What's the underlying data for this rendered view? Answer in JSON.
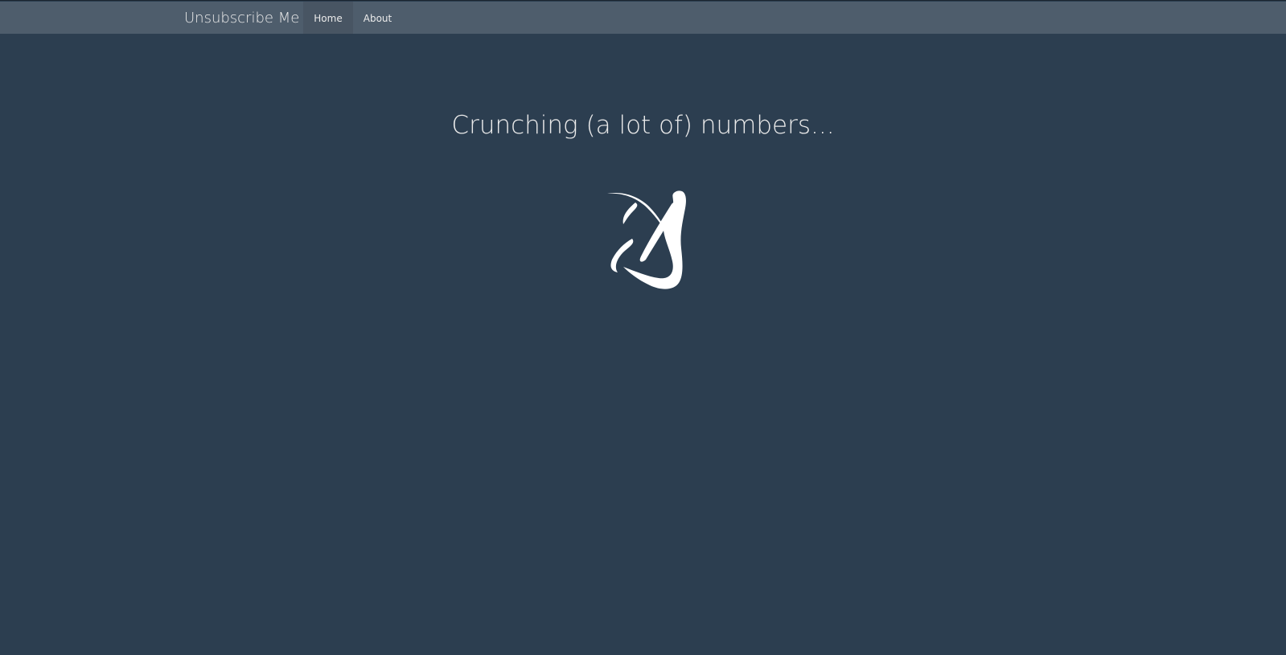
{
  "navbar": {
    "brand": "Unsubscribe Me",
    "items": [
      {
        "label": "Home",
        "active": true
      },
      {
        "label": "About",
        "active": false
      }
    ]
  },
  "main": {
    "headline": "Crunching (a lot of) numbers...",
    "loading_icon": "atom-spinner-icon"
  },
  "colors": {
    "background": "#2c3e50",
    "navbar": "#4e5d6c",
    "active_nav": "#485563",
    "text": "#ebebeb",
    "icon": "#ffffff"
  }
}
